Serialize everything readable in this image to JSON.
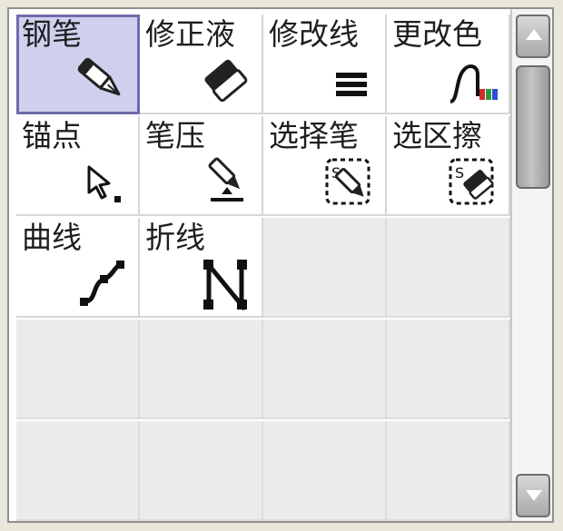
{
  "tools": [
    {
      "id": "pen",
      "label": "钢笔",
      "icon": "pen-icon",
      "selected": true
    },
    {
      "id": "correction-fluid",
      "label": "修正液",
      "icon": "eraser-icon",
      "selected": false
    },
    {
      "id": "modify-line",
      "label": "修改线",
      "icon": "line-width-icon",
      "selected": false
    },
    {
      "id": "change-color",
      "label": "更改色",
      "icon": "color-curve-icon",
      "selected": false
    },
    {
      "id": "anchor",
      "label": "锚点",
      "icon": "anchor-cursor-icon",
      "selected": false
    },
    {
      "id": "pen-pressure",
      "label": "笔压",
      "icon": "pen-pressure-icon",
      "selected": false
    },
    {
      "id": "selection-pen",
      "label": "选择笔",
      "icon": "selection-pen-icon",
      "selected": false
    },
    {
      "id": "selection-eraser",
      "label": "选区擦",
      "icon": "selection-eraser-icon",
      "selected": false
    },
    {
      "id": "curve",
      "label": "曲线",
      "icon": "curve-icon",
      "selected": false
    },
    {
      "id": "polyline",
      "label": "折线",
      "icon": "polyline-icon",
      "selected": false
    }
  ],
  "empty_slots": 10,
  "colors": {
    "selected_bg": "#cfd0ee",
    "selected_border": "#6e6cab",
    "empty_slot_bg": "#ebebeb",
    "icon_red": "#d42a2a",
    "icon_green": "#2a9a3a",
    "icon_blue": "#2a4ed4"
  },
  "scrollbar": {
    "up_icon": "arrow-up-icon",
    "down_icon": "arrow-down-icon"
  }
}
